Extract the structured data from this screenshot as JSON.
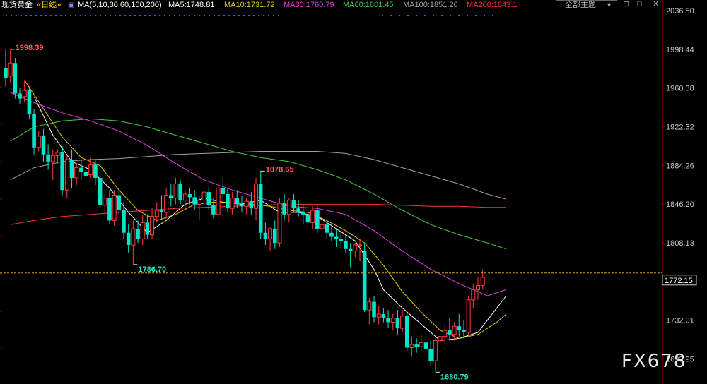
{
  "header": {
    "symbol": "现货黄金",
    "period": "«日线»",
    "ma_group": "MA(5,10,30,60,100,200)",
    "ma_values": [
      {
        "text": "MA5:1748.81",
        "color": "#ffffff"
      },
      {
        "text": "MA10:1731.72",
        "color": "#e6c700"
      },
      {
        "text": "MA30:1760.79",
        "color": "#e040e0"
      },
      {
        "text": "MA60:1801.45",
        "color": "#3fc73f"
      },
      {
        "text": "MA100:1851.26",
        "color": "#a0a0a0"
      },
      {
        "text": "MA200:1843.1",
        "color": "#ff3030"
      }
    ],
    "theme_button": "全部主题",
    "theme_arrow": "▼",
    "window_controls": [
      "⊞",
      "□",
      "✕"
    ]
  },
  "watermark": "FX678",
  "colors": {
    "up": "#ff3c3c",
    "down": "#00e6c8",
    "axis_text": "#c8c8c8",
    "grid": "#8b0000",
    "price_line": "#d4a017"
  },
  "chart_data": {
    "type": "candlestick",
    "y_ticks": [
      "2036.50",
      "1998.44",
      "1960.38",
      "1922.32",
      "1884.26",
      "1846.20",
      "1808.13",
      "1772.15",
      "1732.01",
      "1693.95"
    ],
    "ylim": [
      1672,
      2040
    ],
    "current_price": "1772.15",
    "annotations": [
      {
        "label": "1998.39",
        "index": 1,
        "value": 1998.39,
        "type": "high"
      },
      {
        "label": "1878.65",
        "index": 54,
        "value": 1878.65,
        "type": "high"
      },
      {
        "label": "1786.70",
        "index": 27,
        "value": 1786.7,
        "type": "low"
      },
      {
        "label": "1680.79",
        "index": 91,
        "value": 1680.79,
        "type": "low"
      }
    ],
    "candles": [
      [
        1980,
        1998,
        1962,
        1970
      ],
      [
        1972,
        1998,
        1966,
        1985
      ],
      [
        1985,
        1990,
        1950,
        1955
      ],
      [
        1955,
        1960,
        1945,
        1950
      ],
      [
        1952,
        1968,
        1946,
        1958
      ],
      [
        1958,
        1962,
        1930,
        1935
      ],
      [
        1935,
        1940,
        1895,
        1902
      ],
      [
        1902,
        1918,
        1898,
        1913
      ],
      [
        1913,
        1920,
        1888,
        1895
      ],
      [
        1895,
        1905,
        1880,
        1888
      ],
      [
        1888,
        1900,
        1870,
        1894
      ],
      [
        1894,
        1900,
        1886,
        1897
      ],
      [
        1897,
        1903,
        1855,
        1860
      ],
      [
        1860,
        1895,
        1852,
        1890
      ],
      [
        1890,
        1900,
        1862,
        1872
      ],
      [
        1872,
        1886,
        1865,
        1882
      ],
      [
        1882,
        1890,
        1870,
        1878
      ],
      [
        1878,
        1885,
        1868,
        1874
      ],
      [
        1875,
        1892,
        1872,
        1885
      ],
      [
        1885,
        1890,
        1865,
        1872
      ],
      [
        1872,
        1880,
        1840,
        1845
      ],
      [
        1845,
        1856,
        1835,
        1852
      ],
      [
        1852,
        1860,
        1826,
        1830
      ],
      [
        1830,
        1860,
        1825,
        1855
      ],
      [
        1855,
        1862,
        1835,
        1840
      ],
      [
        1840,
        1848,
        1812,
        1818
      ],
      [
        1818,
        1826,
        1798,
        1806
      ],
      [
        1806,
        1830,
        1787,
        1822
      ],
      [
        1822,
        1830,
        1808,
        1812
      ],
      [
        1812,
        1836,
        1806,
        1828
      ],
      [
        1828,
        1836,
        1812,
        1816
      ],
      [
        1816,
        1842,
        1812,
        1834
      ],
      [
        1834,
        1848,
        1828,
        1840
      ],
      [
        1840,
        1855,
        1832,
        1838
      ],
      [
        1838,
        1862,
        1832,
        1855
      ],
      [
        1855,
        1866,
        1844,
        1852
      ],
      [
        1852,
        1872,
        1846,
        1866
      ],
      [
        1866,
        1870,
        1846,
        1850
      ],
      [
        1850,
        1860,
        1842,
        1856
      ],
      [
        1856,
        1862,
        1846,
        1853
      ],
      [
        1853,
        1860,
        1840,
        1846
      ],
      [
        1846,
        1854,
        1830,
        1850
      ],
      [
        1850,
        1860,
        1844,
        1858
      ],
      [
        1858,
        1864,
        1840,
        1845
      ],
      [
        1845,
        1852,
        1832,
        1836
      ],
      [
        1836,
        1868,
        1830,
        1862
      ],
      [
        1862,
        1872,
        1852,
        1856
      ],
      [
        1856,
        1862,
        1838,
        1842
      ],
      [
        1842,
        1858,
        1836,
        1852
      ],
      [
        1852,
        1860,
        1842,
        1846
      ],
      [
        1846,
        1854,
        1838,
        1844
      ],
      [
        1844,
        1852,
        1836,
        1849
      ],
      [
        1849,
        1858,
        1836,
        1842
      ],
      [
        1842,
        1872,
        1830,
        1866
      ],
      [
        1866,
        1879,
        1812,
        1818
      ],
      [
        1818,
        1828,
        1806,
        1812
      ],
      [
        1812,
        1824,
        1800,
        1822
      ],
      [
        1822,
        1830,
        1802,
        1808
      ],
      [
        1808,
        1852,
        1804,
        1847
      ],
      [
        1847,
        1856,
        1830,
        1836
      ],
      [
        1836,
        1852,
        1828,
        1850
      ],
      [
        1850,
        1856,
        1838,
        1842
      ],
      [
        1842,
        1850,
        1834,
        1838
      ],
      [
        1838,
        1846,
        1826,
        1836
      ],
      [
        1836,
        1842,
        1822,
        1828
      ],
      [
        1828,
        1844,
        1822,
        1840
      ],
      [
        1840,
        1845,
        1818,
        1822
      ],
      [
        1822,
        1834,
        1816,
        1826
      ],
      [
        1826,
        1832,
        1812,
        1818
      ],
      [
        1818,
        1826,
        1810,
        1814
      ],
      [
        1814,
        1822,
        1804,
        1812
      ],
      [
        1812,
        1820,
        1802,
        1810
      ],
      [
        1810,
        1816,
        1798,
        1802
      ],
      [
        1802,
        1808,
        1784,
        1800
      ],
      [
        1800,
        1808,
        1794,
        1806
      ],
      [
        1806,
        1812,
        1790,
        1806
      ],
      [
        1800,
        1808,
        1740,
        1742
      ],
      [
        1742,
        1754,
        1728,
        1750
      ],
      [
        1750,
        1756,
        1730,
        1735
      ],
      [
        1735,
        1746,
        1728,
        1738
      ],
      [
        1738,
        1744,
        1730,
        1734
      ],
      [
        1734,
        1742,
        1724,
        1730
      ],
      [
        1730,
        1738,
        1722,
        1734
      ],
      [
        1734,
        1742,
        1718,
        1724
      ],
      [
        1724,
        1742,
        1720,
        1736
      ],
      [
        1736,
        1740,
        1702,
        1705
      ],
      [
        1705,
        1716,
        1696,
        1708
      ],
      [
        1708,
        1714,
        1700,
        1706
      ],
      [
        1706,
        1718,
        1702,
        1710
      ],
      [
        1710,
        1716,
        1698,
        1704
      ],
      [
        1704,
        1712,
        1688,
        1692
      ],
      [
        1692,
        1714,
        1681,
        1712
      ],
      [
        1712,
        1735,
        1706,
        1716
      ],
      [
        1716,
        1728,
        1708,
        1722
      ],
      [
        1722,
        1734,
        1712,
        1718
      ],
      [
        1718,
        1730,
        1712,
        1726
      ],
      [
        1726,
        1738,
        1716,
        1722
      ],
      [
        1722,
        1732,
        1714,
        1720
      ],
      [
        1720,
        1756,
        1716,
        1752
      ],
      [
        1752,
        1768,
        1744,
        1762
      ],
      [
        1762,
        1774,
        1752,
        1766
      ],
      [
        1766,
        1782,
        1762,
        1774
      ]
    ],
    "ma_lines": [
      {
        "name": "MA5",
        "color": "#ffffff",
        "points": [
          [
            6,
            1952
          ],
          [
            10,
            1914
          ],
          [
            14,
            1888
          ],
          [
            18,
            1880
          ],
          [
            22,
            1862
          ],
          [
            26,
            1838
          ],
          [
            30,
            1818
          ],
          [
            34,
            1830
          ],
          [
            38,
            1846
          ],
          [
            42,
            1852
          ],
          [
            46,
            1848
          ],
          [
            50,
            1846
          ],
          [
            54,
            1850
          ],
          [
            58,
            1838
          ],
          [
            62,
            1838
          ],
          [
            66,
            1834
          ],
          [
            70,
            1822
          ],
          [
            74,
            1810
          ],
          [
            78,
            1782
          ],
          [
            80,
            1762
          ],
          [
            84,
            1744
          ],
          [
            88,
            1728
          ],
          [
            92,
            1712
          ],
          [
            96,
            1714
          ],
          [
            100,
            1720
          ],
          [
            104,
            1744
          ],
          [
            106,
            1756
          ]
        ]
      },
      {
        "name": "MA10",
        "color": "#e6c700",
        "points": [
          [
            4,
            1968
          ],
          [
            8,
            1940
          ],
          [
            12,
            1912
          ],
          [
            16,
            1892
          ],
          [
            20,
            1884
          ],
          [
            24,
            1860
          ],
          [
            28,
            1840
          ],
          [
            32,
            1830
          ],
          [
            36,
            1836
          ],
          [
            40,
            1846
          ],
          [
            44,
            1848
          ],
          [
            48,
            1848
          ],
          [
            52,
            1846
          ],
          [
            56,
            1844
          ],
          [
            60,
            1840
          ],
          [
            64,
            1838
          ],
          [
            68,
            1830
          ],
          [
            72,
            1820
          ],
          [
            76,
            1808
          ],
          [
            80,
            1786
          ],
          [
            84,
            1760
          ],
          [
            88,
            1740
          ],
          [
            92,
            1722
          ],
          [
            96,
            1714
          ],
          [
            100,
            1718
          ],
          [
            104,
            1730
          ],
          [
            106,
            1738
          ]
        ]
      },
      {
        "name": "MA30",
        "color": "#e040e0",
        "points": [
          [
            1,
            1956
          ],
          [
            6,
            1946
          ],
          [
            12,
            1936
          ],
          [
            18,
            1928
          ],
          [
            24,
            1918
          ],
          [
            30,
            1904
          ],
          [
            36,
            1886
          ],
          [
            42,
            1870
          ],
          [
            48,
            1860
          ],
          [
            54,
            1852
          ],
          [
            60,
            1844
          ],
          [
            66,
            1842
          ],
          [
            72,
            1836
          ],
          [
            78,
            1820
          ],
          [
            84,
            1800
          ],
          [
            90,
            1782
          ],
          [
            96,
            1768
          ],
          [
            102,
            1756
          ],
          [
            106,
            1762
          ]
        ]
      },
      {
        "name": "MA60",
        "color": "#3fc73f",
        "points": [
          [
            1,
            1908
          ],
          [
            6,
            1922
          ],
          [
            12,
            1928
          ],
          [
            18,
            1930
          ],
          [
            24,
            1928
          ],
          [
            30,
            1922
          ],
          [
            36,
            1914
          ],
          [
            42,
            1906
          ],
          [
            48,
            1898
          ],
          [
            54,
            1892
          ],
          [
            60,
            1888
          ],
          [
            66,
            1880
          ],
          [
            72,
            1870
          ],
          [
            78,
            1856
          ],
          [
            84,
            1840
          ],
          [
            90,
            1826
          ],
          [
            96,
            1816
          ],
          [
            102,
            1808
          ],
          [
            106,
            1802
          ]
        ]
      },
      {
        "name": "MA100",
        "color": "#a0a0a0",
        "points": [
          [
            1,
            1870
          ],
          [
            6,
            1882
          ],
          [
            12,
            1888
          ],
          [
            18,
            1890
          ],
          [
            24,
            1891
          ],
          [
            30,
            1893
          ],
          [
            36,
            1895
          ],
          [
            42,
            1896
          ],
          [
            48,
            1897
          ],
          [
            54,
            1898
          ],
          [
            60,
            1898
          ],
          [
            66,
            1898
          ],
          [
            72,
            1896
          ],
          [
            78,
            1890
          ],
          [
            84,
            1882
          ],
          [
            90,
            1874
          ],
          [
            96,
            1866
          ],
          [
            102,
            1856
          ],
          [
            106,
            1851
          ]
        ]
      },
      {
        "name": "MA200",
        "color": "#ff3030",
        "points": [
          [
            1,
            1826
          ],
          [
            6,
            1830
          ],
          [
            12,
            1834
          ],
          [
            18,
            1836
          ],
          [
            24,
            1838
          ],
          [
            30,
            1840
          ],
          [
            36,
            1842
          ],
          [
            42,
            1843
          ],
          [
            48,
            1844
          ],
          [
            54,
            1845
          ],
          [
            60,
            1846
          ],
          [
            66,
            1846
          ],
          [
            72,
            1846
          ],
          [
            78,
            1846
          ],
          [
            84,
            1845
          ],
          [
            90,
            1844
          ],
          [
            96,
            1844
          ],
          [
            102,
            1843
          ],
          [
            106,
            1843
          ]
        ]
      }
    ]
  }
}
